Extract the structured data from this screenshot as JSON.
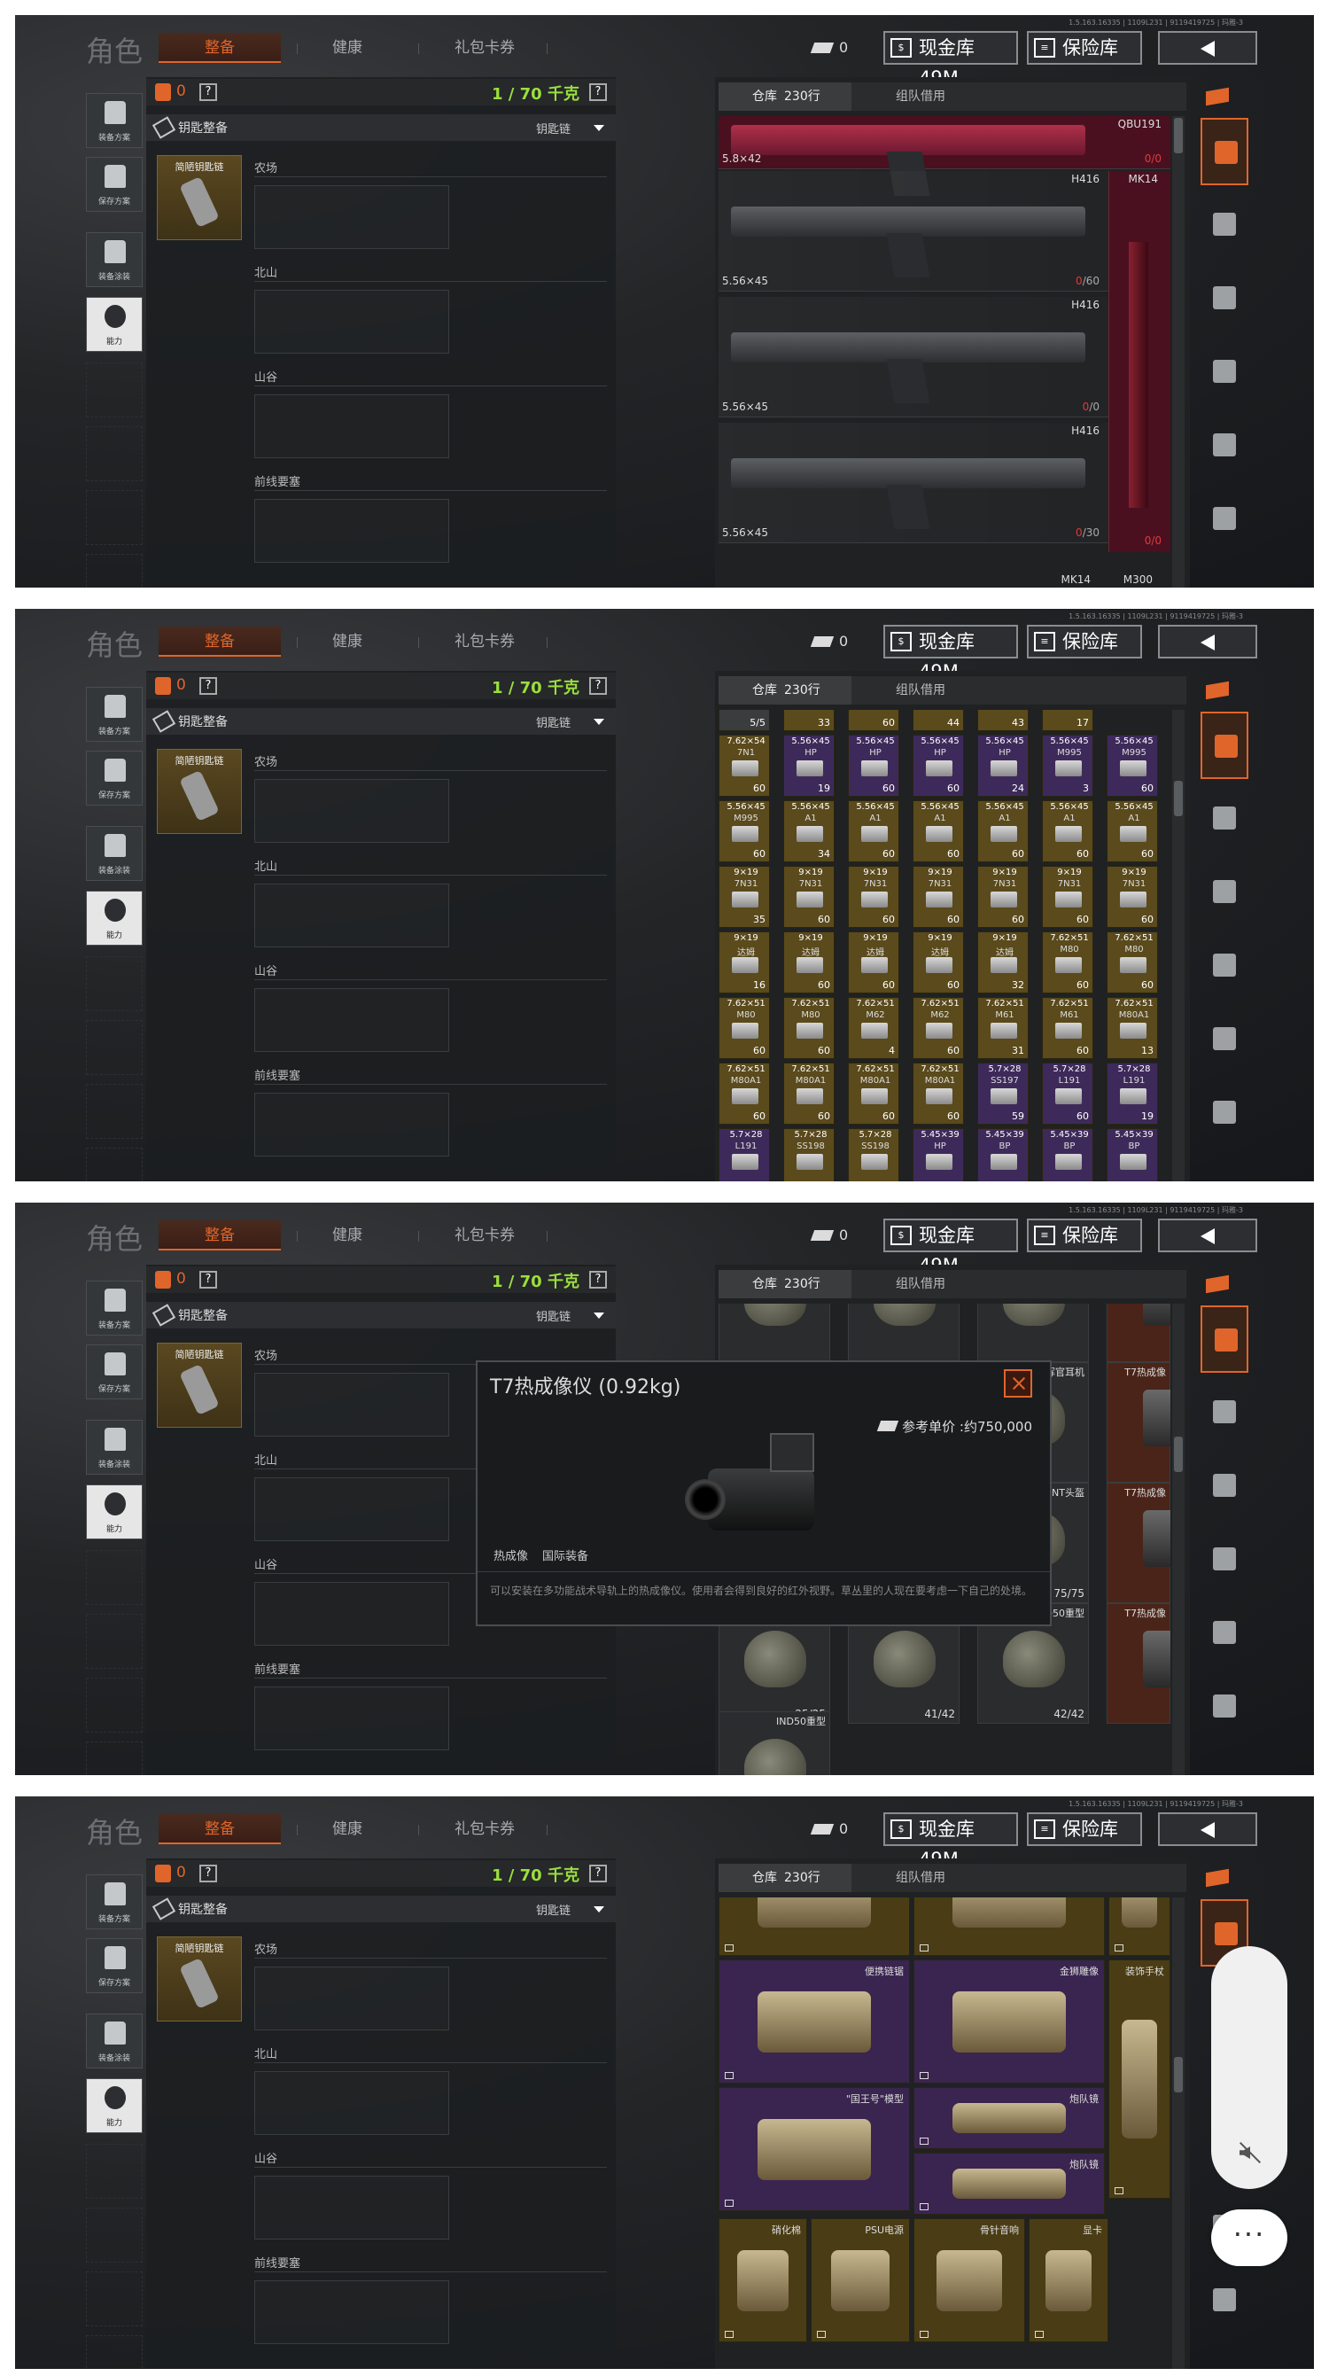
{
  "header": {
    "build_info": "1.5.163.16335 | 1109L231 | 9119419725 | 玛雅-3",
    "role_title": "角色",
    "tabs": [
      "整备",
      "健康",
      "礼包卡券"
    ],
    "coin_count": "0",
    "cash_label": "现金库 49M",
    "safe_label": "保险库"
  },
  "left_buttons": [
    "装备方案",
    "保存方案",
    "装备涂装",
    "能力"
  ],
  "loadout": {
    "vest_count": "0",
    "weight": "1 / 70 千克",
    "help": "?",
    "key_title": "钥匙整备",
    "key_selector": "钥匙链",
    "keycard_label": "简陋钥匙链",
    "regions": [
      "农场",
      "北山",
      "山谷",
      "前线要塞"
    ]
  },
  "storage": {
    "tab_warehouse": "仓库",
    "tab_rows": "230行",
    "tab_team": "组队借用"
  },
  "weapons_view": {
    "top_item": {
      "name": "QBU191",
      "caliber": "5.8×42",
      "count": "0/0"
    },
    "rows": [
      {
        "name": "H416",
        "caliber": "5.56×45",
        "count_red": "0",
        "count_rest": "/60"
      },
      {
        "name": "H416",
        "caliber": "5.56×45",
        "count_red": "0",
        "count_rest": "/0"
      },
      {
        "name": "H416",
        "caliber": "5.56×45",
        "count_red": "0",
        "count_rest": "/30"
      }
    ],
    "mk14_label": "MK14",
    "mk14_count": "0/0",
    "bottom_labels": [
      "MK14",
      "M300"
    ]
  },
  "ammo_view": {
    "top_counts": [
      "5/5",
      "33",
      "60",
      "44",
      "43",
      "17"
    ],
    "rows": [
      [
        [
          "7.62×54",
          "7N1",
          "60",
          "y"
        ],
        [
          "5.56×45",
          "HP",
          "19",
          "p"
        ],
        [
          "5.56×45",
          "HP",
          "60",
          "p"
        ],
        [
          "5.56×45",
          "HP",
          "60",
          "p"
        ],
        [
          "5.56×45",
          "HP",
          "24",
          "p"
        ],
        [
          "5.56×45",
          "M995",
          "3",
          "p"
        ],
        [
          "5.56×45",
          "M995",
          "60",
          "p"
        ]
      ],
      [
        [
          "5.56×45",
          "M995",
          "60",
          "y"
        ],
        [
          "5.56×45",
          "A1",
          "34",
          "y"
        ],
        [
          "5.56×45",
          "A1",
          "60",
          "y"
        ],
        [
          "5.56×45",
          "A1",
          "60",
          "y"
        ],
        [
          "5.56×45",
          "A1",
          "60",
          "y"
        ],
        [
          "5.56×45",
          "A1",
          "60",
          "y"
        ],
        [
          "5.56×45",
          "A1",
          "60",
          "y"
        ]
      ],
      [
        [
          "9×19",
          "7N31",
          "35",
          "y"
        ],
        [
          "9×19",
          "7N31",
          "60",
          "y"
        ],
        [
          "9×19",
          "7N31",
          "60",
          "y"
        ],
        [
          "9×19",
          "7N31",
          "60",
          "y"
        ],
        [
          "9×19",
          "7N31",
          "60",
          "y"
        ],
        [
          "9×19",
          "7N31",
          "60",
          "y"
        ],
        [
          "9×19",
          "7N31",
          "60",
          "y"
        ]
      ],
      [
        [
          "9×19",
          "达姆",
          "16",
          "y"
        ],
        [
          "9×19",
          "达姆",
          "60",
          "y"
        ],
        [
          "9×19",
          "达姆",
          "60",
          "y"
        ],
        [
          "9×19",
          "达姆",
          "60",
          "y"
        ],
        [
          "9×19",
          "达姆",
          "32",
          "y"
        ],
        [
          "7.62×51",
          "M80",
          "60",
          "y"
        ],
        [
          "7.62×51",
          "M80",
          "60",
          "y"
        ]
      ],
      [
        [
          "7.62×51",
          "M80",
          "60",
          "y"
        ],
        [
          "7.62×51",
          "M80",
          "60",
          "y"
        ],
        [
          "7.62×51",
          "M62",
          "4",
          "y"
        ],
        [
          "7.62×51",
          "M62",
          "60",
          "y"
        ],
        [
          "7.62×51",
          "M61",
          "31",
          "y"
        ],
        [
          "7.62×51",
          "M61",
          "60",
          "y"
        ],
        [
          "7.62×51",
          "M80A1",
          "13",
          "y"
        ]
      ],
      [
        [
          "7.62×51",
          "M80A1",
          "60",
          "y"
        ],
        [
          "7.62×51",
          "M80A1",
          "60",
          "y"
        ],
        [
          "7.62×51",
          "M80A1",
          "60",
          "y"
        ],
        [
          "7.62×51",
          "M80A1",
          "60",
          "y"
        ],
        [
          "5.7×28",
          "SS197",
          "59",
          "p"
        ],
        [
          "5.7×28",
          "L191",
          "60",
          "p"
        ],
        [
          "5.7×28",
          "L191",
          "19",
          "p"
        ]
      ],
      [
        [
          "5.7×28",
          "L191",
          "",
          "p"
        ],
        [
          "5.7×28",
          "SS198",
          "",
          "y"
        ],
        [
          "5.7×28",
          "SS198",
          "",
          "y"
        ],
        [
          "5.45×39",
          "HP",
          "",
          "p"
        ],
        [
          "5.45×39",
          "BP",
          "",
          "p"
        ],
        [
          "5.45×39",
          "BP",
          "",
          "p"
        ],
        [
          "5.45×39",
          "BP",
          "",
          "p"
        ]
      ]
    ]
  },
  "helmet_view": {
    "cells": [
      {
        "name": "指挥官耳机",
        "count": ""
      },
      {
        "name": "",
        "count": ""
      },
      {
        "name": "",
        "count": ""
      },
      {
        "name": "",
        "count": ""
      },
      {
        "name": "指挥官耳机",
        "count": ""
      },
      {
        "name": "T7热成像",
        "count": ""
      },
      {
        "name": "BNT头盔",
        "count": "75/75"
      },
      {
        "name": "T7热成像",
        "count": ""
      },
      {
        "name": "",
        "count": "25/25"
      },
      {
        "name": "IND50重型",
        "count": "41/42"
      },
      {
        "name": "IND50重型",
        "count": "42/42"
      },
      {
        "name": "T7热成像",
        "count": ""
      },
      {
        "name": "IND50重型",
        "count": ""
      }
    ],
    "popup": {
      "title": "T7热成像仪 (0.92kg)",
      "price": "参考单价 :约750,000",
      "tag1": "热成像",
      "tag2": "国际装备",
      "description": "可以安装在多功能战术导轨上的热成像仪。使用者会得到良好的红外视野。草丛里的人现在要考虑一下自己的处境。"
    }
  },
  "misc_view": {
    "items": [
      "便携链锯",
      "金狮雕像",
      "装饰手杖",
      "\"国王号\"模型",
      "炮队镜",
      "炮队镜",
      "硝化棉",
      "PSU电源",
      "骨针音响",
      "显卡"
    ]
  },
  "overlay": {
    "more": "···"
  }
}
